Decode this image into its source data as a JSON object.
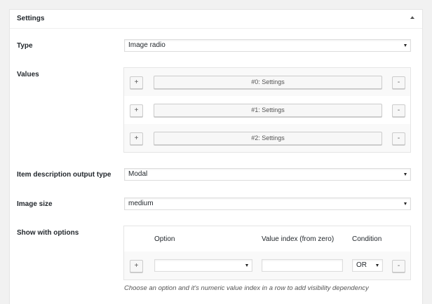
{
  "panel": {
    "title": "Settings",
    "toggle_icon": "triangle-up-icon"
  },
  "type_row": {
    "label": "Type",
    "value": "Image radio"
  },
  "values_row": {
    "label": "Values",
    "add_label": "+",
    "remove_label": "-",
    "items": [
      {
        "label": "#0: Settings"
      },
      {
        "label": "#1: Settings"
      },
      {
        "label": "#2: Settings"
      }
    ]
  },
  "description_row": {
    "label": "Item description output type",
    "value": "Modal"
  },
  "image_size_row": {
    "label": "Image size",
    "value": "medium"
  },
  "show_options_row": {
    "label": "Show with options",
    "columns": {
      "option": "Option",
      "value_index": "Value index (from zero)",
      "condition": "Condition"
    },
    "row": {
      "add_label": "+",
      "option_value": "",
      "value_index_value": "",
      "condition_value": "OR",
      "remove_label": "-"
    },
    "hint": "Choose an option and it's numeric value index in a row to add visibility dependency"
  }
}
